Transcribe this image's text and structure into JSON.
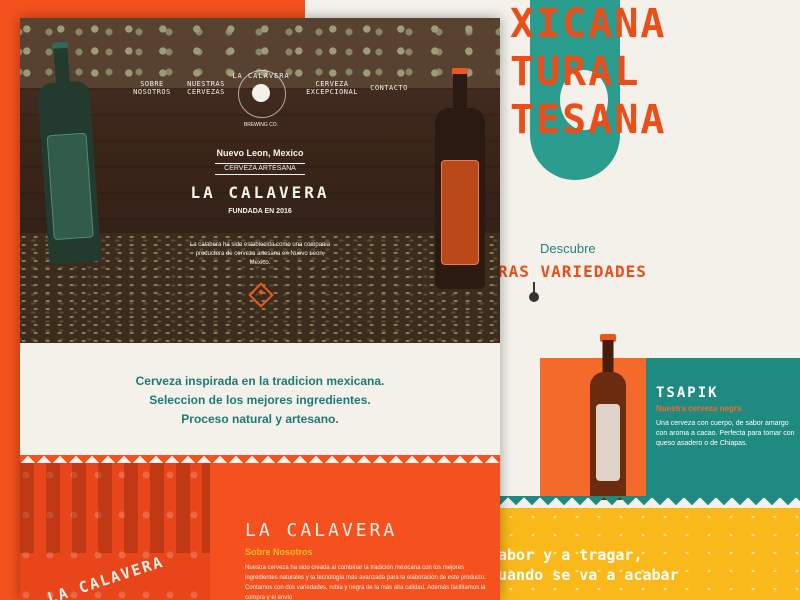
{
  "background": {
    "title_lines": [
      "XICANA",
      "TURAL",
      "TESANA"
    ],
    "discover_label": "Descubre",
    "varieties_label": "RAS VARIEDADES",
    "product": {
      "name": "TSAPIK",
      "subtitle": "Nuestra cerveza negra",
      "description": "Una cerveza con cuerpo, de sabor amargo con aroma a cacao. Perfecta para tomar con queso asadero o de Chiapas."
    },
    "yellow_text_lines": [
      "abor y a tragar,",
      "uando se va a acabar"
    ]
  },
  "nav": {
    "items": [
      {
        "line1": "SOBRE",
        "line2": "NOSOTROS"
      },
      {
        "line1": "NUESTRAS",
        "line2": "CERVEZAS"
      },
      {
        "line1": "CERVEZA",
        "line2": "EXCEPCIONAL"
      },
      {
        "line1": "CONTACTO",
        "line2": ""
      }
    ],
    "logo_top": "LA CALAVERA",
    "logo_bottom": "BREWING CO."
  },
  "hero": {
    "place": "Nuevo Leon, Mexico",
    "badge": "CERVEZA ARTESANA",
    "title": "LA CALAVERA",
    "founded": "FUNDADA EN 2016",
    "description": "La calabera ha sido establecida como una compania productora de cerveza artesana en Nuevo Leon, Mexico."
  },
  "intro": {
    "lines": [
      "Cerveza inspirada en la tradicion mexicana.",
      "Seleccion de los mejores ingredientes.",
      "Proceso natural y artesano."
    ]
  },
  "about": {
    "seal_text": "LA CALAVERA",
    "title": "LA CALAVERA",
    "subtitle": "Sobre Nosotros",
    "text": "Nuestra cerveza ha sido creada al combinar la tradición mexicana con los mejores ingredientes naturales y la tecnología más avanzada para la elaboración de este producto. Contamos con dos variedades, rubia y negra de la más alta calidad. Además facilitamos la compra y el envío"
  },
  "colors": {
    "orange": "#f4511e",
    "teal": "#1f8a80",
    "yellow": "#f9b91b",
    "cream": "#f3f1ea"
  }
}
